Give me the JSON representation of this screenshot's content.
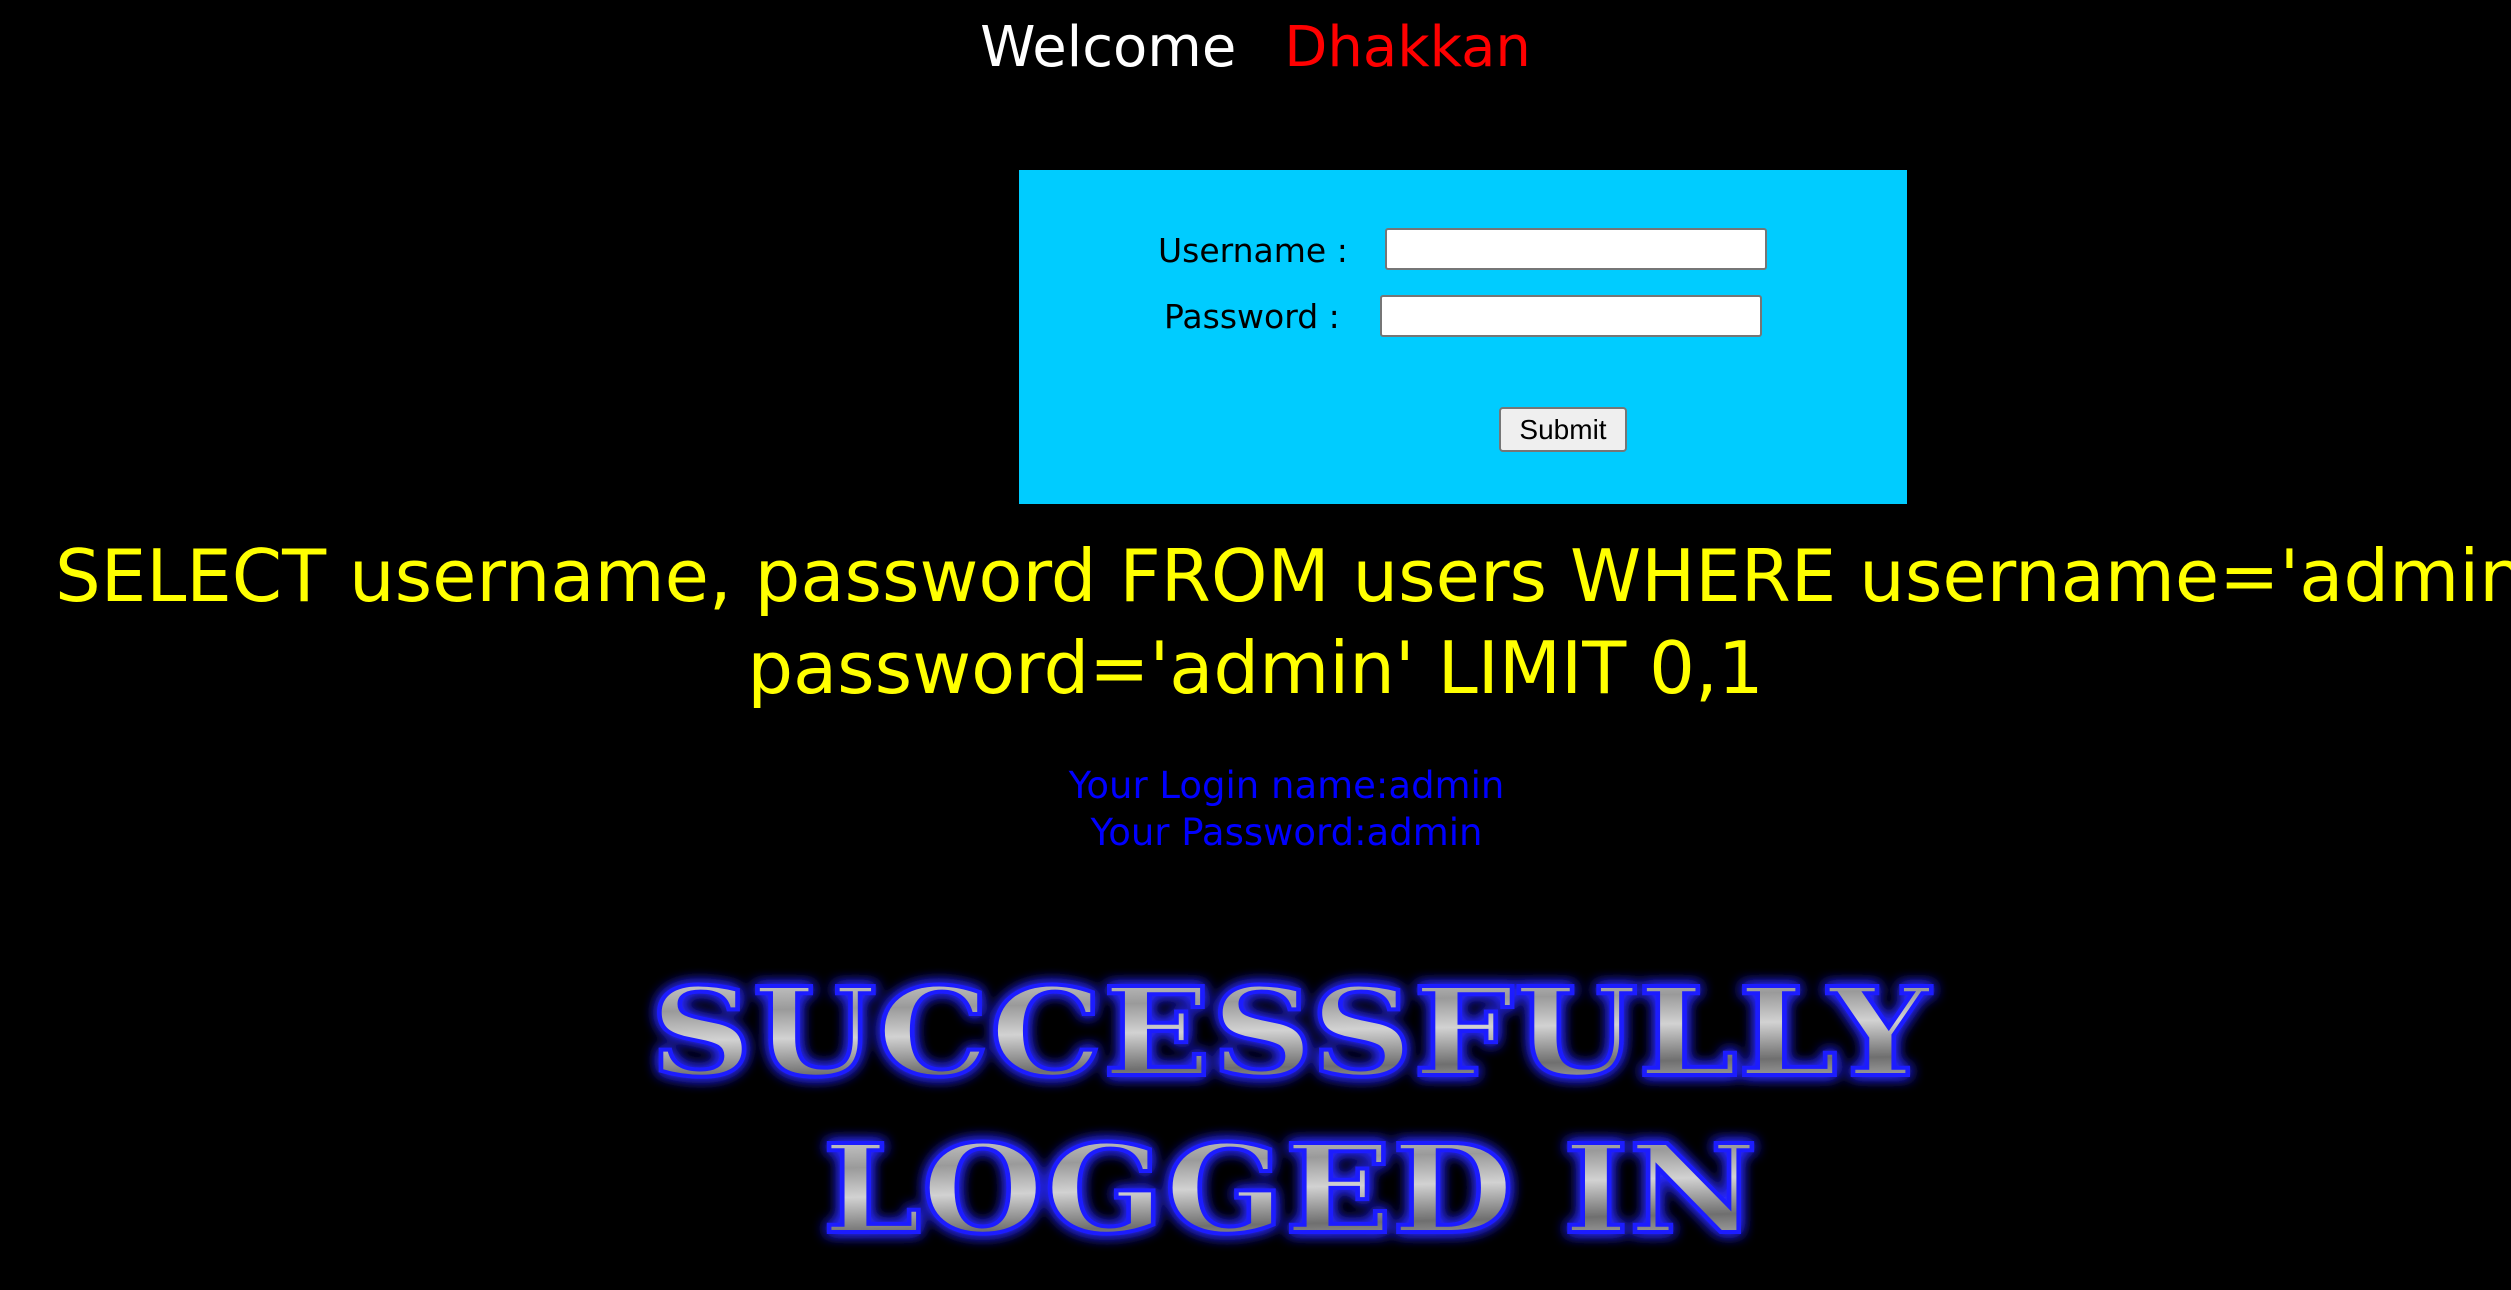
{
  "header": {
    "welcome_label": "Welcome",
    "user_name": "Dhakkan"
  },
  "login_form": {
    "username_label": "Username :",
    "username_value": "",
    "password_label": "Password :",
    "password_value": "",
    "submit_label": "Submit"
  },
  "query": {
    "line1": "SELECT username, password FROM users WHERE username='admin' and",
    "line2": "password='admin' LIMIT 0,1"
  },
  "result": {
    "login_name": "Your Login name:admin",
    "password": "Your Password:admin"
  },
  "banner": {
    "line1": "SUCCESSFULLY",
    "line2": "LOGGED IN"
  },
  "colors": {
    "background": "#000000",
    "form_background": "#00ccff",
    "query_text": "#ffff00",
    "result_text": "#0000ff",
    "user_name": "#ff0000",
    "banner_glow": "#2222ff"
  }
}
